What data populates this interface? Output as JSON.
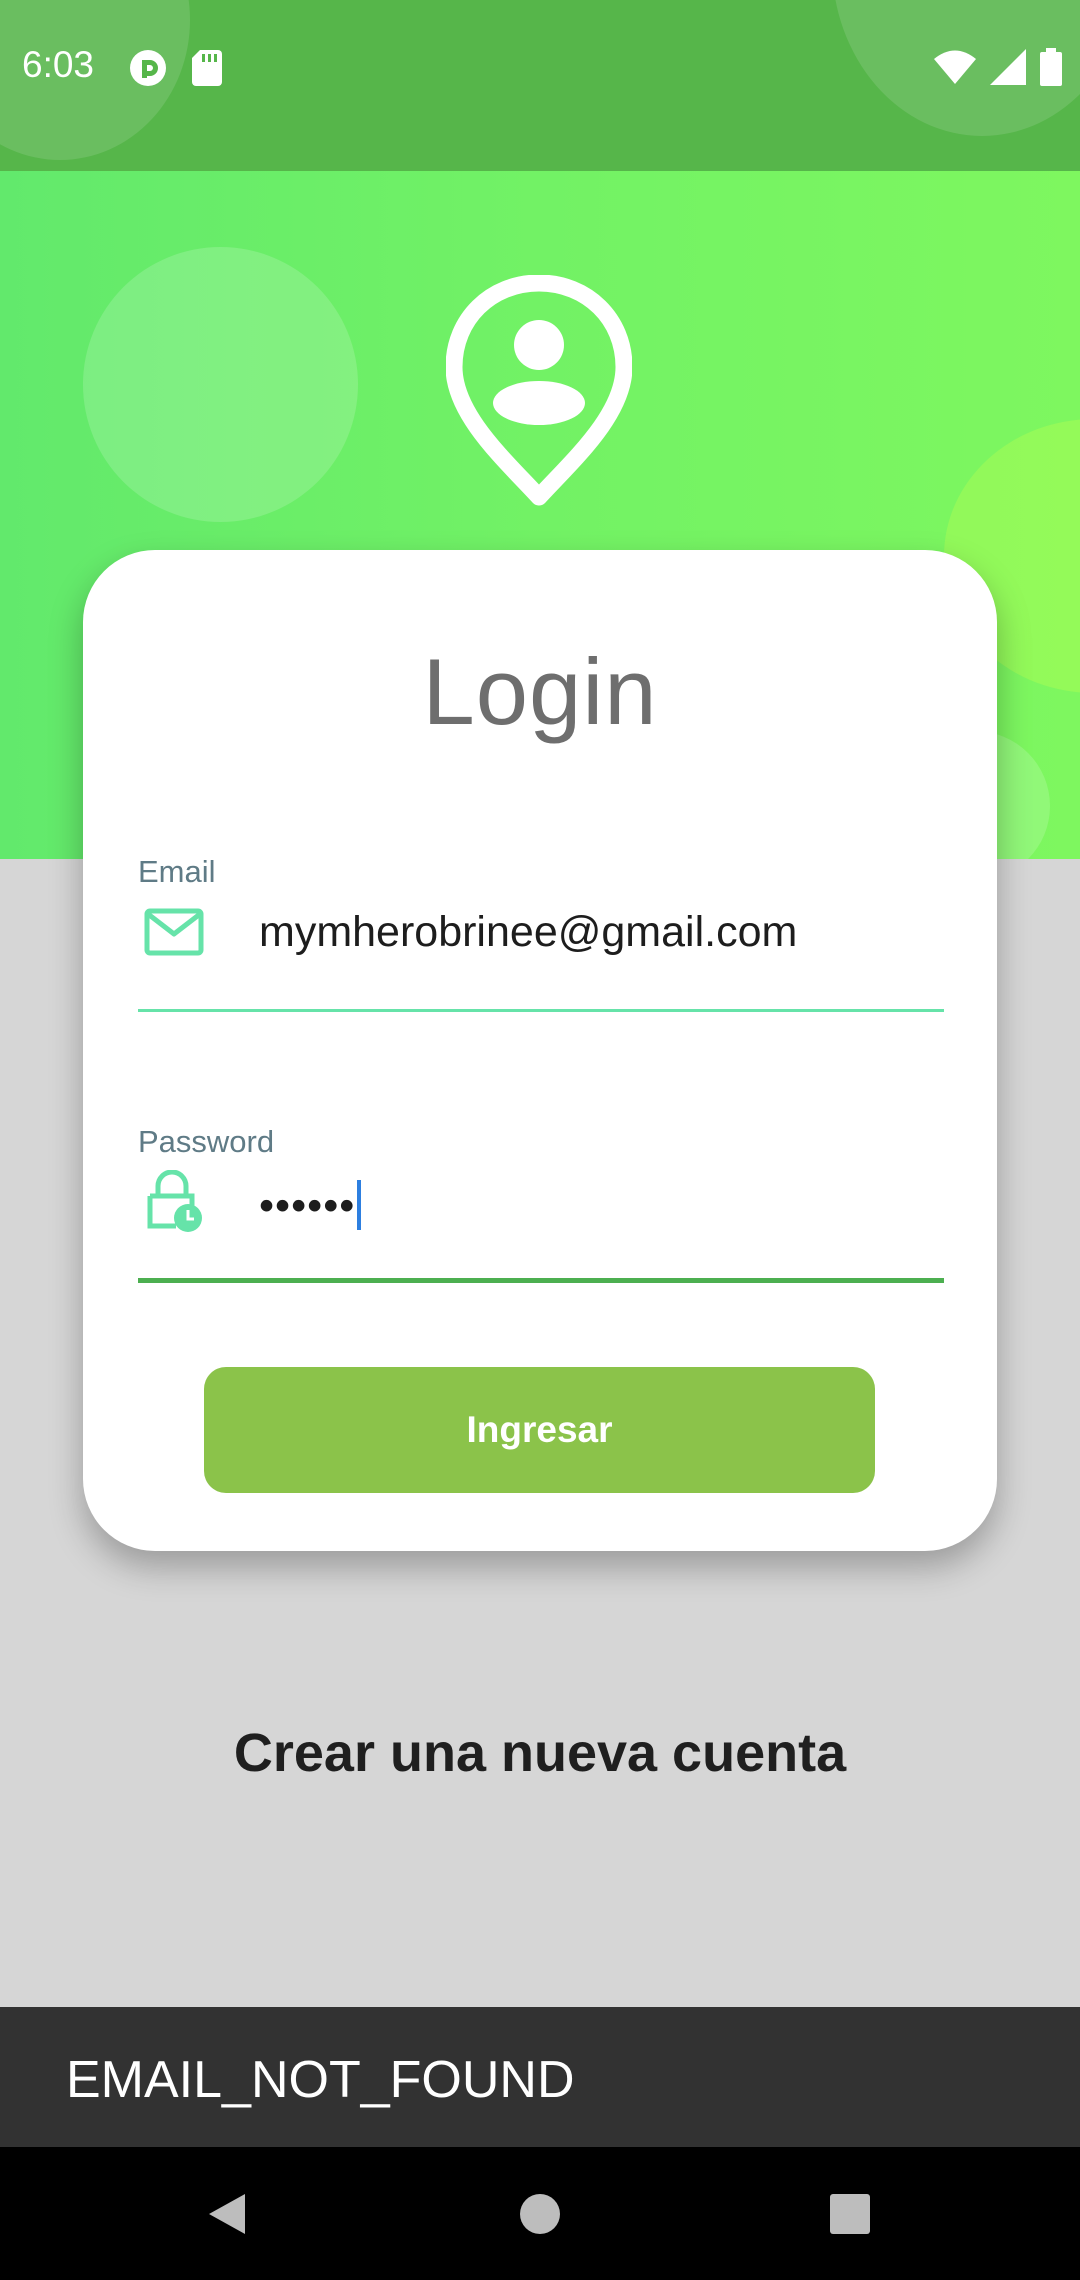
{
  "status_bar": {
    "time": "6:03",
    "left_icons": [
      "pocket-casts-icon",
      "sd-card-icon"
    ],
    "right_icons": [
      "wifi-icon",
      "signal-icon",
      "battery-icon"
    ]
  },
  "colors": {
    "status_bar": "#56b64a",
    "header_gradient_start": "#62e96c",
    "header_gradient_end": "#7ef75f",
    "accent_teal": "#66e3a9",
    "button": "#8bc34a",
    "focused_line": "#4caf50",
    "background": "#d6d6d6",
    "snackbar": "#323232"
  },
  "header": {
    "logo_icon": "location-person-pin-icon"
  },
  "login": {
    "title": "Login",
    "email": {
      "label": "Email",
      "value": "mymherobrinee@gmail.com",
      "icon": "mail-icon"
    },
    "password": {
      "label": "Password",
      "value": "••••••",
      "icon": "lock-clock-icon"
    },
    "submit_label": "Ingresar"
  },
  "register_link": "Crear una nueva cuenta",
  "snackbar": {
    "message": "EMAIL_NOT_FOUND"
  },
  "nav_bar": {
    "buttons": [
      "back-icon",
      "home-icon",
      "recents-icon"
    ]
  }
}
